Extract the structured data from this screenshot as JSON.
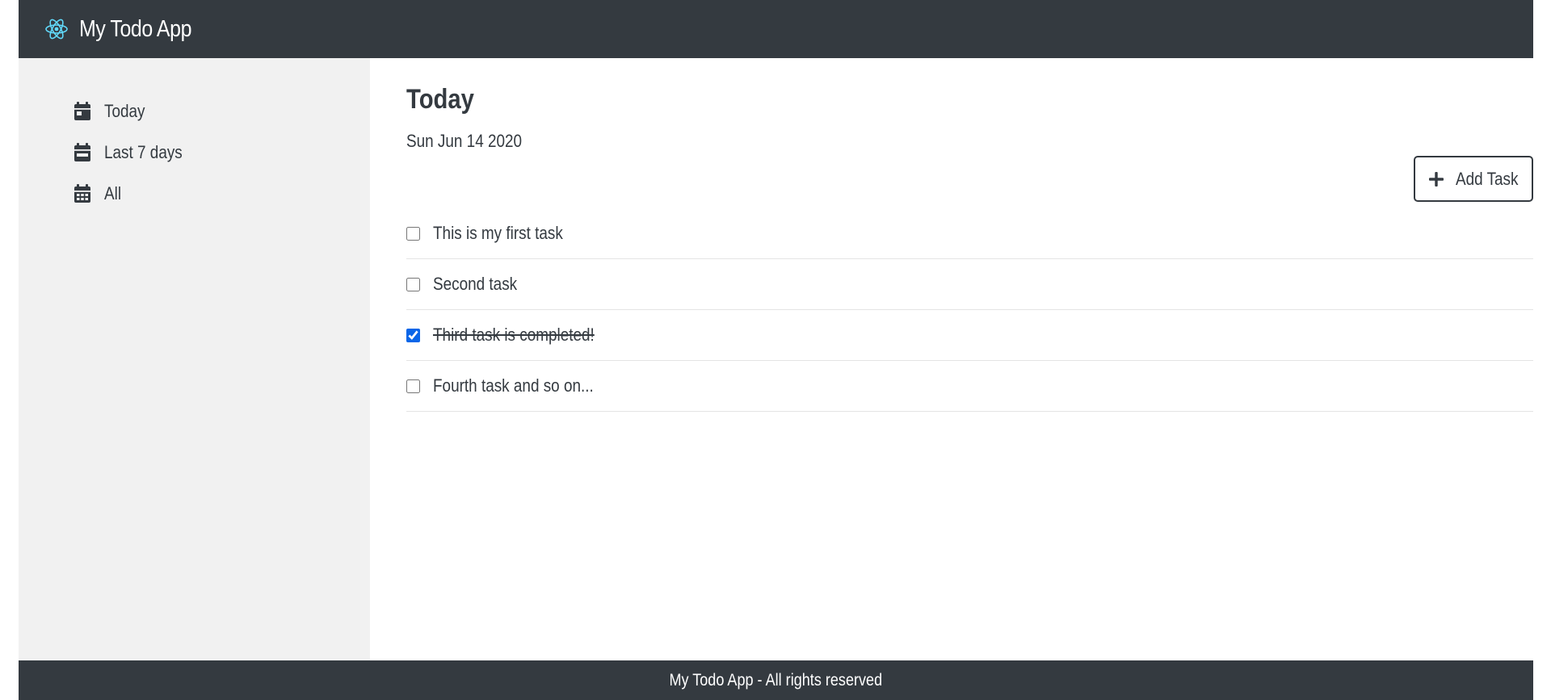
{
  "header": {
    "logo_icon": "react-atom-icon",
    "logo_color": "#61dafb",
    "title": "My Todo App",
    "background": "#343a40"
  },
  "sidebar": {
    "items": [
      {
        "label": "Today",
        "icon": "calendar-day-icon"
      },
      {
        "label": "Last 7 days",
        "icon": "calendar-week-icon"
      },
      {
        "label": "All",
        "icon": "calendar-alt-icon"
      }
    ]
  },
  "main": {
    "title": "Today",
    "date": "Sun Jun 14 2020",
    "add_button": {
      "label": "Add Task",
      "icon": "plus-icon"
    },
    "tasks": [
      {
        "text": "This is my first task",
        "completed": false
      },
      {
        "text": "Second task",
        "completed": false
      },
      {
        "text": "Third task is completed!",
        "completed": true
      },
      {
        "text": "Fourth task and so on...",
        "completed": false
      }
    ]
  },
  "footer": {
    "text": "My Todo App - All rights reserved"
  },
  "colors": {
    "dark": "#343a40",
    "sidebar_bg": "#f1f1f1",
    "checkbox_accent": "#0a66e8"
  }
}
